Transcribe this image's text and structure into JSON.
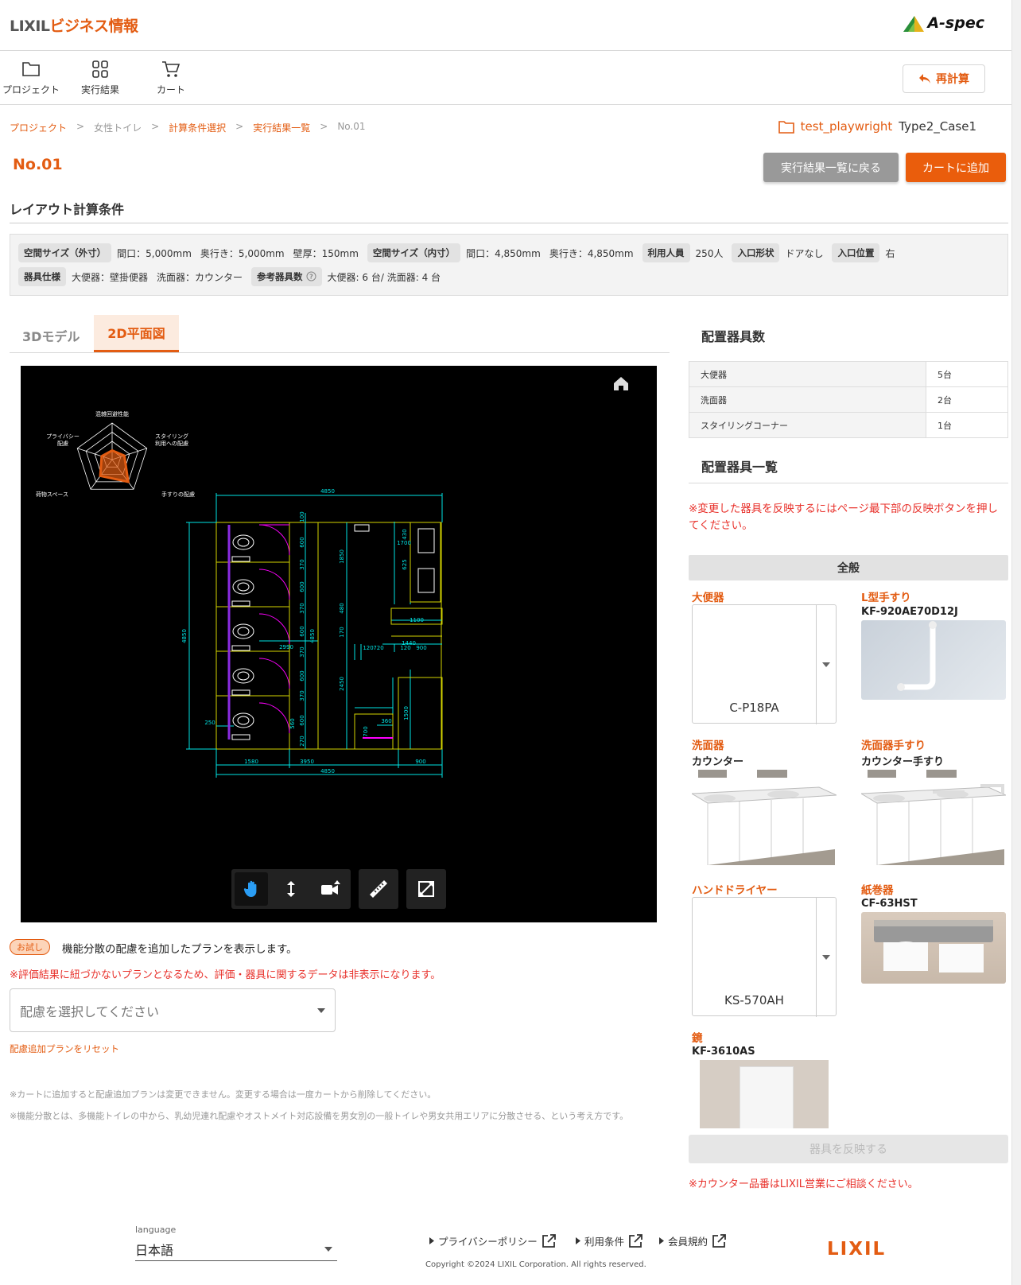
{
  "header": {
    "brand_prefix": "LIXIL",
    "brand_suffix": "ビジネス情報",
    "product": "A-spec"
  },
  "nav": {
    "project": "プロジェクト",
    "results": "実行結果",
    "cart": "カート",
    "recalc": "再計算"
  },
  "breadcrumb": [
    "プロジェクト",
    "女性トイレ",
    "計算条件選択",
    "実行結果一覧",
    "No.01"
  ],
  "project_info": {
    "name": "test_playwright",
    "case": "Type2_Case1"
  },
  "page": {
    "title": "No.01",
    "back_button": "実行結果一覧に戻る",
    "cart_button": "カートに追加",
    "section_title": "レイアウト計算条件"
  },
  "conditions": {
    "outer_size_label": "空間サイズ（外寸）",
    "outer_width": "間口：5,000mm",
    "outer_depth": "奥行き：5,000mm",
    "wall": "壁厚：150mm",
    "inner_size_label": "空間サイズ（内寸）",
    "inner_width": "間口：4,850mm",
    "inner_depth": "奥行き：4,850mm",
    "users_label": "利用人員",
    "users": "250人",
    "entrance_label": "入口形状",
    "entrance": "ドアなし",
    "entrance_pos_label": "入口位置",
    "entrance_pos": "右",
    "fixture_label": "器具仕様",
    "toilet_spec": "大便器：壁掛便器",
    "basin_spec": "洗面器：カウンター",
    "ref_count_label": "参考器具数",
    "ref_count": "大便器: 6 台/ 洗面器: 4 台"
  },
  "tabs": {
    "model3d": "3Dモデル",
    "plan2d": "2D平面図"
  },
  "radar": {
    "axes": [
      "混雑回避性能",
      "スタイリング\n利用への配慮",
      "手すりの配慮",
      "荷物スペース",
      "プライバシー\n配慮"
    ],
    "values": [
      0.25,
      0.35,
      0.75,
      0.55,
      0.3
    ]
  },
  "drawing_labels": {
    "total_width_top": "4850",
    "total_width_bottom": "4850",
    "height_left": "4850",
    "height_mid": "4850",
    "d100": "100",
    "d600a": "600",
    "d370a": "370",
    "d600b": "600",
    "d370b": "370",
    "d600c": "600",
    "d370c": "370",
    "d600d": "600",
    "d370d": "370",
    "d560": "560",
    "d600e": "600",
    "d270": "270",
    "d1850": "1850",
    "d480": "480",
    "d170": "170",
    "d2450": "2450",
    "d700": "700",
    "d430": "430",
    "d1700": "1700",
    "d625": "625",
    "d1100": "1100",
    "d1440": "1440",
    "d120a": "120",
    "d720": "720",
    "d120b": "120",
    "d900a": "900",
    "d2990": "2990",
    "d360": "360",
    "d1500": "1500",
    "d250": "250",
    "d1580": "1580",
    "d3950": "3950",
    "d900b": "900"
  },
  "trial": {
    "badge": "お試し",
    "text": "機能分散の配慮を追加したプランを表示します。",
    "warning": "※評価結果に紐づかないプランとなるため、評価・器具に関するデータは非表示になります。",
    "select_placeholder": "配慮を選択してください",
    "reset": "配慮追加プランをリセット",
    "note1": "※カートに追加すると配慮追加プランは変更できません。変更する場合は一度カートから削除してください。",
    "note2": "※機能分散とは、多機能トイレの中から、乳幼児連れ配慮やオストメイト対応設備を男女別の一般トイレや男女共用エリアに分散させる、という考え方です。"
  },
  "fixture_count": {
    "title": "配置器具数",
    "rows": [
      {
        "name": "大便器",
        "count": "5台"
      },
      {
        "name": "洗面器",
        "count": "2台"
      },
      {
        "name": "スタイリングコーナー",
        "count": "1台"
      }
    ]
  },
  "fixture_list": {
    "title": "配置器具一覧",
    "warning": "※変更した器具を反映するにはページ最下部の反映ボタンを押してください。",
    "group": "全般",
    "toilet": {
      "category": "大便器",
      "value": "C-P18PA"
    },
    "lrail": {
      "category": "L型手すり",
      "model": "KF-920AE70D12J"
    },
    "basin": {
      "category": "洗面器",
      "model": "カウンター"
    },
    "basin_rail": {
      "category": "洗面器手すり",
      "model": "カウンター手すり"
    },
    "dryer": {
      "category": "ハンドドライヤー",
      "value": "KS-570AH"
    },
    "paper": {
      "category": "紙巻器",
      "model": "CF-63HST"
    },
    "mirror": {
      "category": "鏡",
      "model": "KF-3610AS"
    },
    "reflect_button": "器具を反映する",
    "counter_note": "※カウンター品番はLIXIL営業にご相談ください。"
  },
  "footer": {
    "language_label": "language",
    "language": "日本語",
    "privacy": "プライバシーポリシー",
    "terms": "利用条件",
    "member": "会員規約",
    "copyright": "Copyright ©2024 LIXIL Corporation. All rights reserved.",
    "logo": "LIXIL"
  },
  "colors": {
    "accent": "#e35c12",
    "warning": "#e8302a",
    "canvas": "#000000"
  }
}
